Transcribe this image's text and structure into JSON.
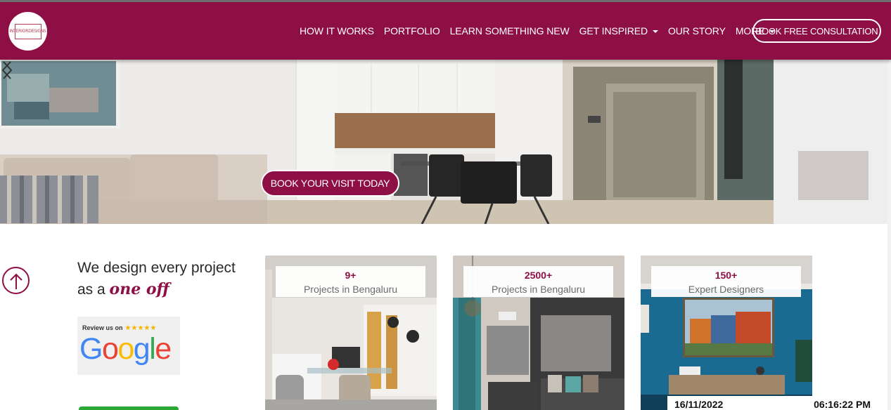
{
  "brand": {
    "logo_text": "INTERIORDESIGNS",
    "accent_color": "#8e0f45"
  },
  "nav": {
    "items": [
      {
        "label": "HOW IT WORKS",
        "dropdown": false
      },
      {
        "label": "PORTFOLIO",
        "dropdown": false
      },
      {
        "label": "LEARN SOMETHING NEW",
        "dropdown": false
      },
      {
        "label": "GET INSPIRED",
        "dropdown": true
      },
      {
        "label": "OUR STORY",
        "dropdown": false
      },
      {
        "label": "MORE",
        "dropdown": true
      }
    ],
    "cta_label": "BOOK FREE CONSULTATION"
  },
  "hero": {
    "cta_label": "BOOK YOUR VISIT TODAY",
    "prev_icon": "chevron-left-icon",
    "next_icon": "chevron-right-icon"
  },
  "intro": {
    "tagline_part1": "We design every project as a ",
    "tagline_accent": "one off"
  },
  "review_badge": {
    "text": "Review us on",
    "stars": "★★★★★",
    "brand": "Google"
  },
  "stats": [
    {
      "count": "9+",
      "label": "Projects in Bengaluru"
    },
    {
      "count": "2500+",
      "label": "Projects in Bengaluru"
    },
    {
      "count": "150+",
      "label": "Expert Designers"
    }
  ],
  "clock": {
    "date": "16/11/2022",
    "time": "06:16:22 PM"
  }
}
